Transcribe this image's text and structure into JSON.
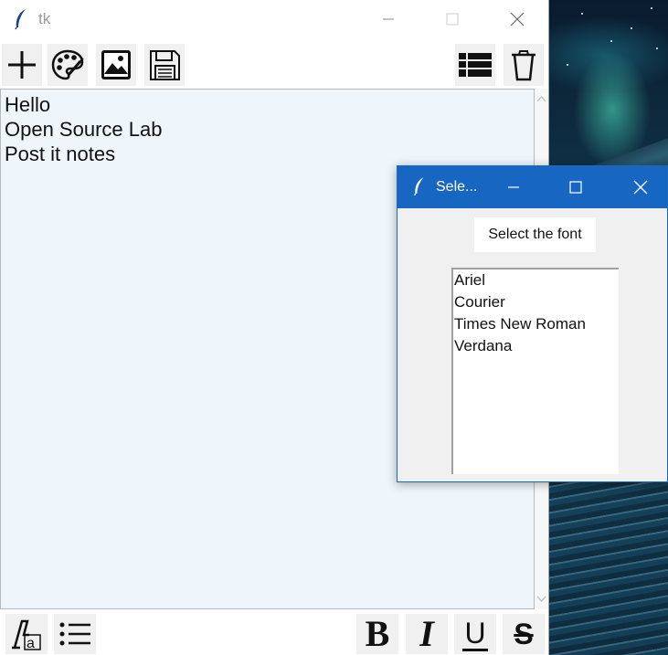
{
  "desktop": {
    "name": "desktop-background"
  },
  "main_window": {
    "title": "tk",
    "toolbar": {
      "left": [
        {
          "name": "add-note-button",
          "icon": "plus-icon"
        },
        {
          "name": "color-palette-button",
          "icon": "palette-icon"
        },
        {
          "name": "insert-image-button",
          "icon": "image-icon"
        },
        {
          "name": "save-button",
          "icon": "floppy-disk-icon"
        }
      ],
      "right": [
        {
          "name": "list-notes-button",
          "icon": "list-icon"
        },
        {
          "name": "delete-button",
          "icon": "trash-icon"
        }
      ]
    },
    "editor": {
      "lines": [
        "Hello",
        "Open Source Lab",
        "Post it notes"
      ]
    },
    "bottom_toolbar": {
      "left": [
        {
          "name": "font-button",
          "icon": "font-icon"
        },
        {
          "name": "bullet-list-button",
          "icon": "bullet-list-icon"
        }
      ],
      "right": [
        {
          "name": "bold-button",
          "icon": "bold-icon",
          "glyph": "B"
        },
        {
          "name": "italic-button",
          "icon": "italic-icon",
          "glyph": "I"
        },
        {
          "name": "underline-button",
          "icon": "underline-icon",
          "glyph": "U"
        },
        {
          "name": "strikethrough-button",
          "icon": "strikethrough-icon",
          "glyph": "S"
        }
      ]
    }
  },
  "font_dialog": {
    "title": "Sele...",
    "label": "Select the font",
    "options": [
      "Ariel",
      "Courier",
      "Times New Roman",
      "Verdana"
    ]
  },
  "colors": {
    "editor_bg": "#eef6fc",
    "dialog_title_bg": "#1766c2",
    "button_bg": "#f0f0f0"
  }
}
